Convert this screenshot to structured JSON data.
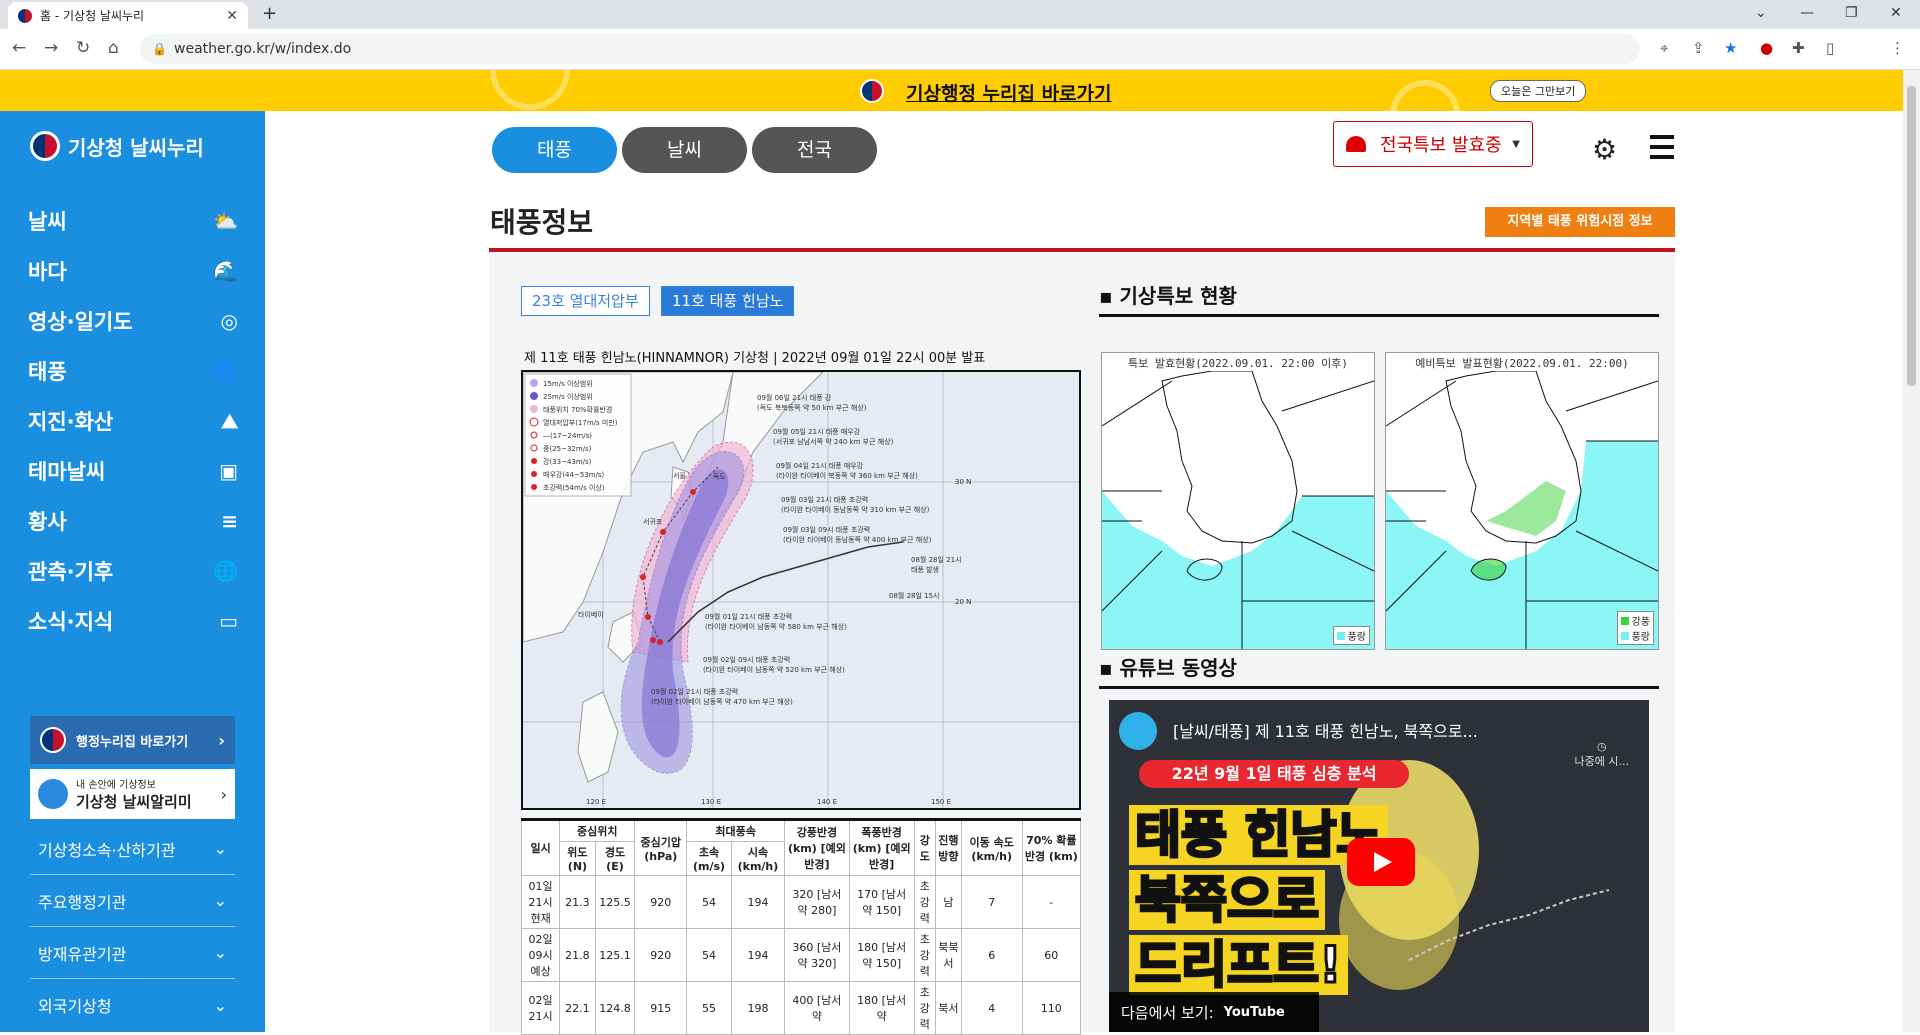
{
  "browser": {
    "tab_title": "홈 - 기상청 날씨누리",
    "url": "weather.go.kr/w/index.do"
  },
  "banner": {
    "text": "기상행정 누리집 바로가기",
    "close_label": "오늘은 그만보기"
  },
  "sidebar": {
    "logo": "기상청 날씨누리",
    "items": [
      {
        "label": "날씨",
        "icon": "cloud-sun-icon"
      },
      {
        "label": "바다",
        "icon": "wave-icon"
      },
      {
        "label": "영상·일기도",
        "icon": "satellite-icon"
      },
      {
        "label": "태풍",
        "icon": "typhoon-icon"
      },
      {
        "label": "지진·화산",
        "icon": "volcano-icon"
      },
      {
        "label": "테마날씨",
        "icon": "briefcase-icon"
      },
      {
        "label": "황사",
        "icon": "dust-icon"
      },
      {
        "label": "관측·기후",
        "icon": "globe-icon"
      },
      {
        "label": "소식·지식",
        "icon": "video-icon"
      }
    ],
    "admin_link": "행정누리집 바로가기",
    "app_line1": "내 손안에 기상정보",
    "app_line2": "기상청 날씨알리미",
    "subnav": [
      "기상청소속·산하기관",
      "주요행정기관",
      "방재유관기관",
      "외국기상청"
    ]
  },
  "main": {
    "tabs": [
      "태풍",
      "날씨",
      "전국"
    ],
    "special_dropdown": "전국특보 발효중",
    "page_title": "태풍정보",
    "risk_button": "지역별 태풍 위험시점 정보",
    "typhoon_tabs": [
      "23호 열대저압부",
      "11호 태풍 힌남노"
    ],
    "caption": "제 11호 태풍 힌남노(HINNAMNOR) 기상청 | 2022년 09월 01일 22시 00분 발표",
    "map_legend": [
      "15m/s 이상범위",
      "25m/s 이상범위",
      "태풍위치 70%확률반경",
      "열대저압부(17m/s 미만)",
      "―(17~24m/s)",
      "중(25~32m/s)",
      "강(33~43m/s)",
      "매우강(44~53m/s)",
      "초강력(54m/s 이상)"
    ],
    "map_labels": [
      "09월 06일 21시 태풍 강",
      "(독도 북북동쪽 약 50 km 부근 해상)",
      "09월 05일 21시 태풍 매우강",
      "(서귀포 남남서쪽 약 240 km 부근 해상)",
      "09월 04일 21시 태풍 매우강",
      "(타이완 타이베이 북동쪽 약 360 km 부근 해상)",
      "09월 03일 21시 태풍 초강력",
      "(타이완 타이베이 동남동쪽 약 310 km 부근 해상)",
      "09월 03일 09시 태풍 초강력",
      "(타이완 타이베이 동남동쪽 약 400 km 부근 해상)",
      "09월 01일 21시 태풍 초강력",
      "(타이완 타이베이 남동쪽 약 580 km 부근 해상)",
      "09월 02일 09시 태풍 초강력",
      "(타이완 타이베이 남동쪽 약 520 km 부근 해상)",
      "09월 02일 21시 태풍 초강력",
      "(타이완 타이베이 남동쪽 약 470 km 부근 해상)",
      "08월 28일 21시",
      "태풍 발생",
      "08월 28일 15시",
      "서울",
      "독도",
      "서귀포",
      "타이베이",
      "30 N",
      "20 N",
      "120 E",
      "130 E",
      "140 E",
      "150 E"
    ],
    "table": {
      "headers": {
        "date": "일시",
        "center": "중심위치",
        "lat": "위도 (N)",
        "lon": "경도 (E)",
        "pressure": "중심기압 (hPa)",
        "maxwind": "최대풍속",
        "ms": "초속 (m/s)",
        "kmh": "시속 (km/h)",
        "strong_radius": "강풍반경 (km) [예외반경]",
        "storm_radius": "폭풍반경 (km) [예외반경]",
        "intensity": "강도",
        "direction": "진행 방향",
        "speed": "이동 속도 (km/h)",
        "prob": "70% 확률 반경 (km)"
      },
      "rows": [
        {
          "date": "01일 21시 현재",
          "lat": "21.3",
          "lon": "125.5",
          "pressure": "920",
          "ms": "54",
          "kmh": "194",
          "strong": "320 [남서 약 280]",
          "storm": "170 [남서 약 150]",
          "intensity": "초강력",
          "dir": "남",
          "speed": "7",
          "prob": "-"
        },
        {
          "date": "02일 09시 예상",
          "lat": "21.8",
          "lon": "125.1",
          "pressure": "920",
          "ms": "54",
          "kmh": "194",
          "strong": "360 [남서 약 320]",
          "storm": "180 [남서 약 150]",
          "intensity": "초강력",
          "dir": "북북서",
          "speed": "6",
          "prob": "60"
        },
        {
          "date": "02일 21시",
          "lat": "22.1",
          "lon": "124.8",
          "pressure": "915",
          "ms": "55",
          "kmh": "198",
          "strong": "400 [남서 약",
          "storm": "180 [남서 약",
          "intensity": "초강력",
          "dir": "북서",
          "speed": "4",
          "prob": "110"
        }
      ]
    },
    "warning_section": {
      "title": "기상특보 현황",
      "map1_header": "특보 발효현황(2022.09.01. 22:00 이후)",
      "map2_header": "예비특보 발표현황(2022.09.01. 22:00)",
      "legend_gale": "풍랑",
      "legend_strong": "강풍",
      "colors": {
        "gale": "#6ff2f2",
        "strong": "#3ad13a"
      }
    },
    "video_section": {
      "title": "유튜브 동영상",
      "video_title": "[날씨/태풍] 제 11호 태풍 힌남노, 북쪽으로...",
      "later": "나중에 시...",
      "banner": "22년 9월 1일 태풍 심층 분석",
      "big1": "태풍 힌남노",
      "big2": "북쪽으로",
      "big3": "드리프트!",
      "watch_on": "다음에서 보기:",
      "youtube": "YouTube"
    }
  }
}
